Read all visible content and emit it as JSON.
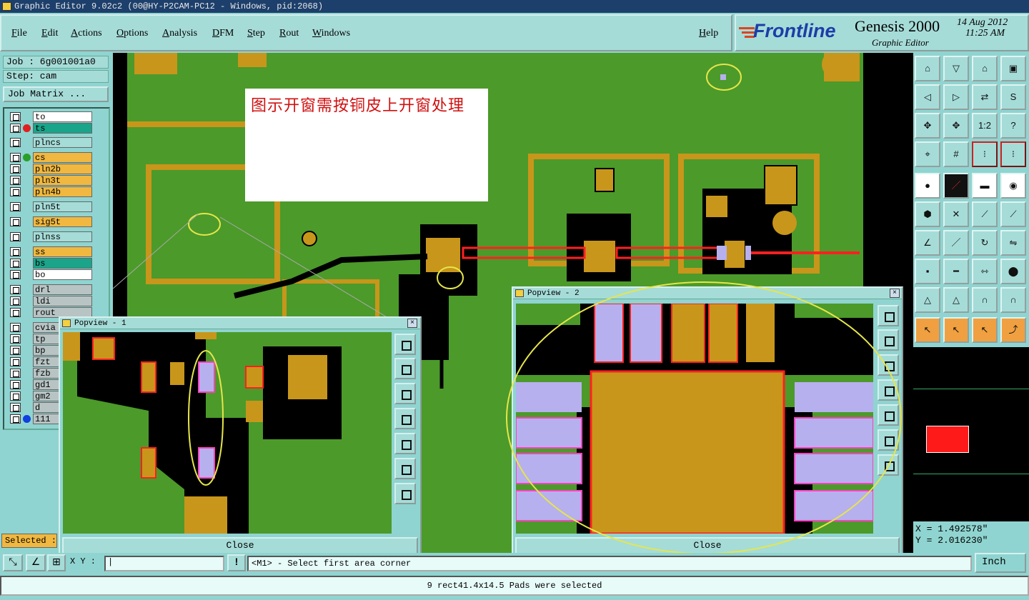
{
  "window": {
    "title": "Graphic Editor 9.02c2 (00@HY-P2CAM-PC12 - Windows, pid:2068)"
  },
  "menu": [
    "File",
    "Edit",
    "Actions",
    "Options",
    "Analysis",
    "DFM",
    "Step",
    "Rout",
    "Windows"
  ],
  "help_label": "Help",
  "brand": {
    "logo": "Frontline",
    "product": "Genesis 2000",
    "subtitle": "Graphic Editor",
    "date": "14 Aug 2012",
    "time": "11:25 AM"
  },
  "job": {
    "line": "Job : 6g001001a0",
    "step": "Step: cam",
    "matrix_button": "Job Matrix ..."
  },
  "layers": [
    {
      "name": "to",
      "color": "#ffffff"
    },
    {
      "name": "ts",
      "color": "#1aa58a"
    },
    {
      "name": "plncs",
      "color": "#a6dcd8"
    },
    {
      "name": "cs",
      "color": "#f0b840"
    },
    {
      "name": "pln2b",
      "color": "#f0b840"
    },
    {
      "name": "pln3t",
      "color": "#f0b840"
    },
    {
      "name": "pln4b",
      "color": "#f0b840"
    },
    {
      "name": "pln5t",
      "color": "#a6dcd8"
    },
    {
      "name": "sig5t",
      "color": "#f0b840"
    },
    {
      "name": "plnss",
      "color": "#a6dcd8"
    },
    {
      "name": "ss",
      "color": "#f0b840"
    },
    {
      "name": "bs",
      "color": "#1aa58a"
    },
    {
      "name": "bo",
      "color": "#ffffff"
    },
    {
      "name": "drl",
      "color": "#b8c4c4"
    },
    {
      "name": "ldi",
      "color": "#b8c4c4"
    },
    {
      "name": "rout",
      "color": "#b8c4c4"
    },
    {
      "name": "cvia",
      "color": "#b8c4c4"
    },
    {
      "name": "tp",
      "color": "#b8c4c4"
    },
    {
      "name": "bp",
      "color": "#b8c4c4"
    },
    {
      "name": "fzt",
      "color": "#b8c4c4"
    },
    {
      "name": "fzb",
      "color": "#b8c4c4"
    },
    {
      "name": "gd1",
      "color": "#b8c4c4"
    },
    {
      "name": "gm2",
      "color": "#b8c4c4"
    },
    {
      "name": "d",
      "color": "#b8c4c4"
    },
    {
      "name": "111",
      "color": "#b8c4c4"
    }
  ],
  "selected_label": "Selected :",
  "annotation": "图示开窗需按铜皮上开窗处理",
  "popup1": {
    "title": "Popview - 1",
    "close": "Close"
  },
  "popup2": {
    "title": "Popview - 2",
    "close": "Close"
  },
  "coords": {
    "x": "X = 1.492578\"",
    "y": "Y = 2.016230\""
  },
  "xy_label": "X Y :",
  "xy_value": "|",
  "prompt": "<M1> - Select first area corner",
  "units": "Inch",
  "status": "9 rect41.4x14.5 Pads were selected",
  "colors": {
    "board_green": "#4c9a2a",
    "copper": "#c8961a",
    "pad": "#b6b0ee",
    "outline": "#ff2020",
    "highlight": "#e6e64a"
  }
}
